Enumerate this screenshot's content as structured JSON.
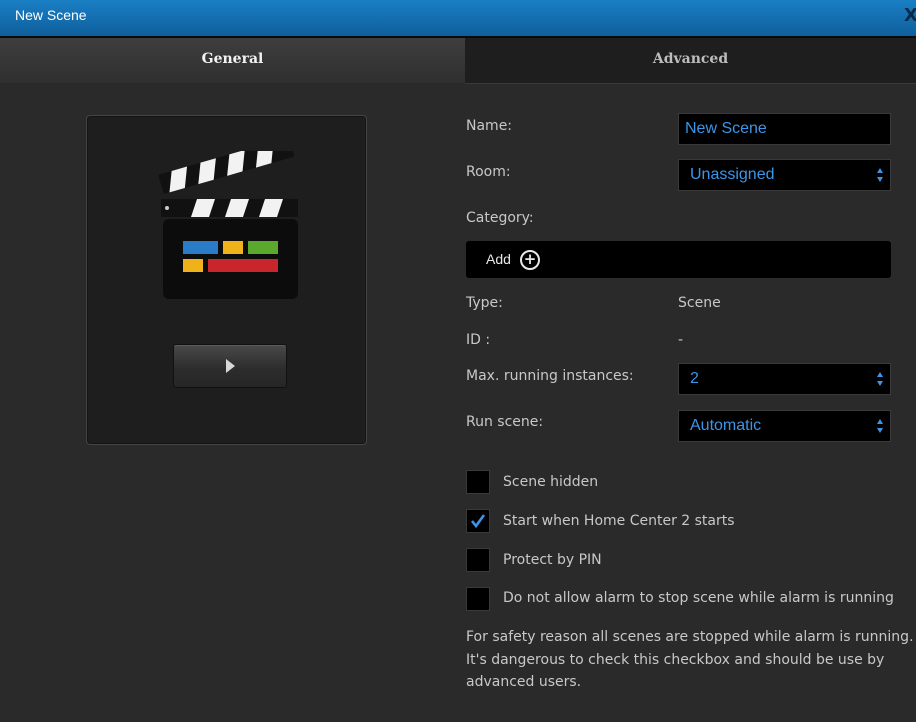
{
  "window": {
    "title": "New Scene",
    "close_label": "X"
  },
  "tabs": [
    {
      "label": "General"
    },
    {
      "label": "Advanced"
    }
  ],
  "form": {
    "name": {
      "label": "Name:",
      "value": "New Scene"
    },
    "room": {
      "label": "Room:",
      "value": "Unassigned"
    },
    "category": {
      "label": "Category:",
      "add_label": "Add"
    },
    "type": {
      "label": "Type:",
      "value": "Scene"
    },
    "id": {
      "label": "ID :",
      "value": "-"
    },
    "max_instances": {
      "label": "Max. running instances:",
      "value": "2"
    },
    "run_scene": {
      "label": "Run scene:",
      "value": "Automatic"
    }
  },
  "checkboxes": [
    {
      "label": "Scene hidden",
      "checked": false
    },
    {
      "label": "Start when Home Center 2 starts",
      "checked": true
    },
    {
      "label": "Protect by PIN",
      "checked": false
    },
    {
      "label": "Do not allow alarm to stop scene while alarm is running",
      "checked": false
    }
  ],
  "note": {
    "line1": "For safety reason all scenes are stopped while alarm is running.",
    "line2": "It's dangerous to check this checkbox and should be use by",
    "line3": "advanced users."
  },
  "colors": {
    "accent": "#3d95e8",
    "titlebar": "#1577bd",
    "background": "#2a2a2a"
  },
  "icons": {
    "scene_icon": "clapperboard-icon",
    "play": "play-icon",
    "add": "plus-circle-icon",
    "check": "checkmark-icon"
  }
}
